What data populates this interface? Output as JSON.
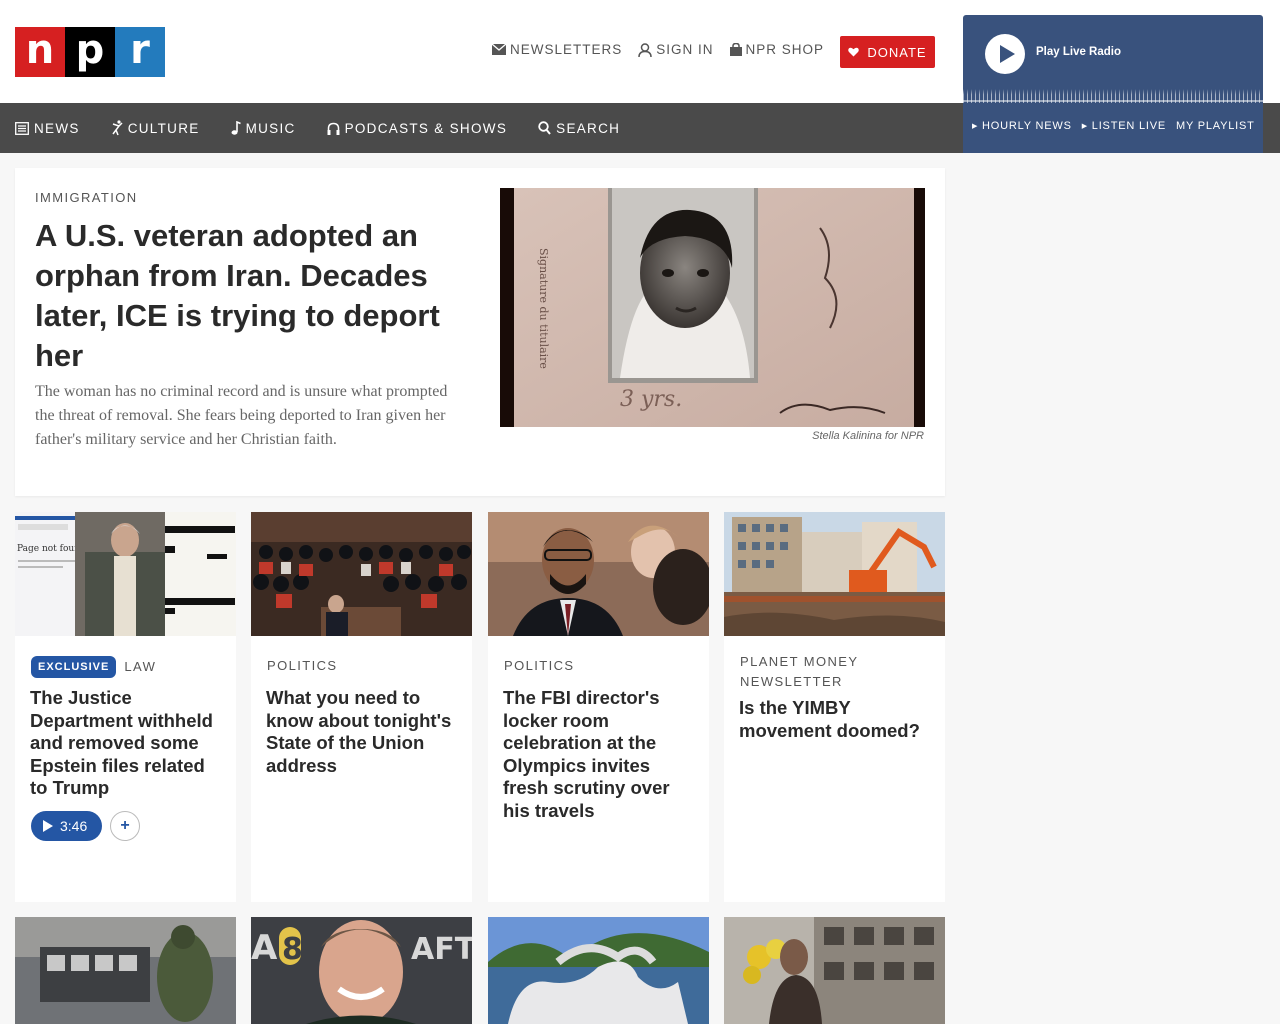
{
  "logo": {
    "letters": [
      "n",
      "p",
      "r"
    ]
  },
  "utility": {
    "newsletters": "NEWSLETTERS",
    "sign_in": "SIGN IN",
    "shop": "NPR SHOP",
    "donate": "DONATE"
  },
  "nav": {
    "news": "NEWS",
    "culture": "CULTURE",
    "music": "MUSIC",
    "podcasts": "PODCASTS & SHOWS",
    "search": "SEARCH"
  },
  "radio": {
    "title": "Play Live Radio",
    "links": [
      "HOURLY NEWS",
      "LISTEN LIVE",
      "MY PLAYLIST"
    ]
  },
  "hero": {
    "slug": "IMMIGRATION",
    "title": "A U.S. veteran adopted an orphan from Iran. Decades later, ICE is trying to deport her",
    "teaser": "The woman has no criminal record and is unsure what prompted the threat of removal. She fears being deported to Iran given her father's military service and her Christian faith.",
    "credit": "Stella Kalinina for NPR",
    "photo_text": {
      "side": "Signature du titulaire",
      "age": "3 yrs."
    }
  },
  "cards": [
    {
      "badge": "EXCLUSIVE",
      "slug": "LAW",
      "title": "The Justice Department withheld and removed some Epstein files related to Trump",
      "audio": "3:46",
      "add": "+",
      "thumb_text": "Page not found"
    },
    {
      "slug": "POLITICS",
      "title": "What you need to know about tonight's State of the Union address"
    },
    {
      "slug": "POLITICS",
      "title": "The FBI director's locker room celebration at the Olympics invites fresh scrutiny over his travels"
    },
    {
      "slug": "PLANET MONEY NEWSLETTER",
      "title": "Is the YIMBY movement doomed?"
    }
  ],
  "row2": {
    "bafta_text": "AFTA",
    "bafta_num": "8"
  },
  "colors": {
    "npr_red": "#d62021",
    "npr_blue": "#237bbd",
    "nav_bg": "#4a4a4a",
    "radio_bg": "#39527d",
    "badge_blue": "#2456a4"
  }
}
